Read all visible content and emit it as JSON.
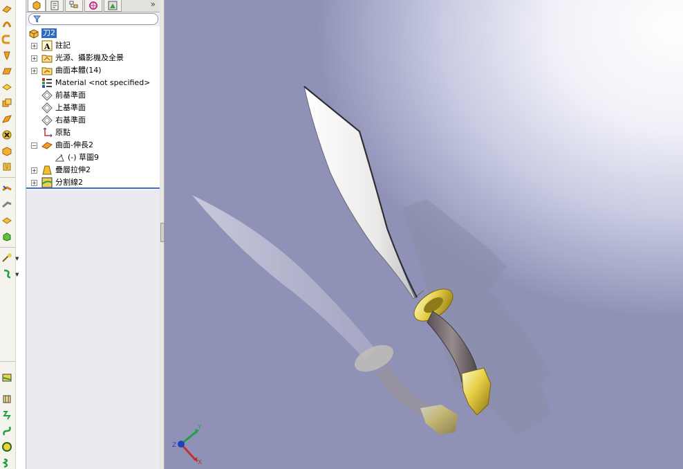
{
  "feature_manager": {
    "tree": {
      "root": "刀2",
      "items": [
        {
          "label": "註記",
          "expand": "+"
        },
        {
          "label": "光源、攝影機及全景",
          "expand": "+"
        },
        {
          "label": "曲面本體(14)",
          "expand": "+"
        },
        {
          "label": "Material <not specified>",
          "expand": ""
        },
        {
          "label": "前基準面",
          "expand": ""
        },
        {
          "label": "上基準面",
          "expand": ""
        },
        {
          "label": "右基準面",
          "expand": ""
        },
        {
          "label": "原點",
          "expand": ""
        },
        {
          "label": "曲面-伸長2",
          "expand": "−"
        },
        {
          "label": "(-) 草圖9",
          "expand": ""
        },
        {
          "label": "疊層拉伸2",
          "expand": "+"
        },
        {
          "label": "分割線2",
          "expand": "+"
        }
      ]
    },
    "more_tabs": "»"
  },
  "triad": {
    "x": "X",
    "y": "Y",
    "z": "Z"
  },
  "colors": {
    "selection": "#316ac5",
    "rollback_bar": "#3a6fc7",
    "blade": "#f4f4f2",
    "guard_gold": "#d8c23a",
    "grip": "#6f6468"
  }
}
